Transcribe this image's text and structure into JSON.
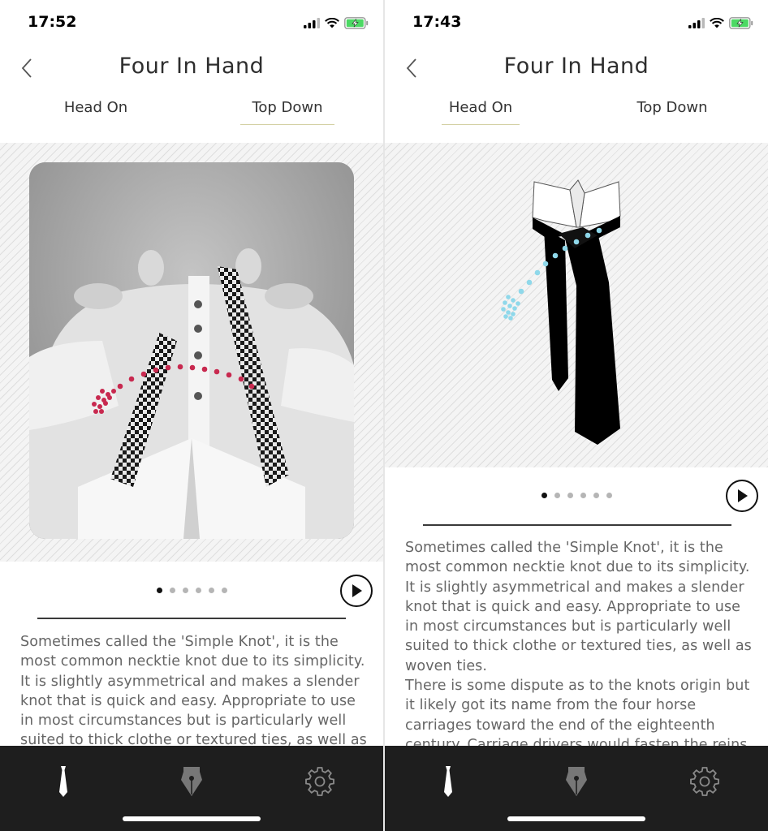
{
  "screens": [
    {
      "status": {
        "time": "17:52"
      },
      "title": "Four In Hand",
      "tabs": [
        {
          "label": "Head On",
          "active": false
        },
        {
          "label": "Top Down",
          "active": true
        }
      ],
      "illustration": {
        "icon": "top-down-photo",
        "dots_color": "#c8294f"
      },
      "carousel": {
        "count": 6,
        "active": 0
      },
      "description": [
        "Sometimes called the 'Simple Knot', it is the most common necktie knot due to its simplicity. It is slightly asymmetrical and makes a slender knot that is quick and easy. Appropriate to use in most circumstances but is particularly well suited to thick clothe or textured ties, as well as woven ties."
      ],
      "tab_bar": {
        "items": [
          "tie-icon",
          "pen-nib-icon",
          "gear-icon"
        ],
        "active": 0
      }
    },
    {
      "status": {
        "time": "17:43"
      },
      "title": "Four In Hand",
      "tabs": [
        {
          "label": "Head On",
          "active": true
        },
        {
          "label": "Top Down",
          "active": false
        }
      ],
      "illustration": {
        "icon": "tie-diagram",
        "dots_color": "#8fd8ea"
      },
      "carousel": {
        "count": 6,
        "active": 0
      },
      "description": [
        "Sometimes called the 'Simple Knot', it is the most common necktie knot due to its simplicity. It is slightly asymmetrical and makes a slender knot that is quick and easy. Appropriate to use in most circumstances but is particularly well suited to thick clothe or textured ties, as well as woven ties.",
        "There is some dispute as to the knots origin but it likely got its name from the four horse carriages toward the end of the eighteenth century. Carriage drivers would fasten the reins"
      ],
      "tab_bar": {
        "items": [
          "tie-icon",
          "pen-nib-icon",
          "gear-icon"
        ],
        "active": 0
      }
    }
  ],
  "colors": {
    "tab_bar_bg": "#1e1e1e",
    "accent_underline": "#d3d0a3",
    "battery": "#4cd964"
  }
}
